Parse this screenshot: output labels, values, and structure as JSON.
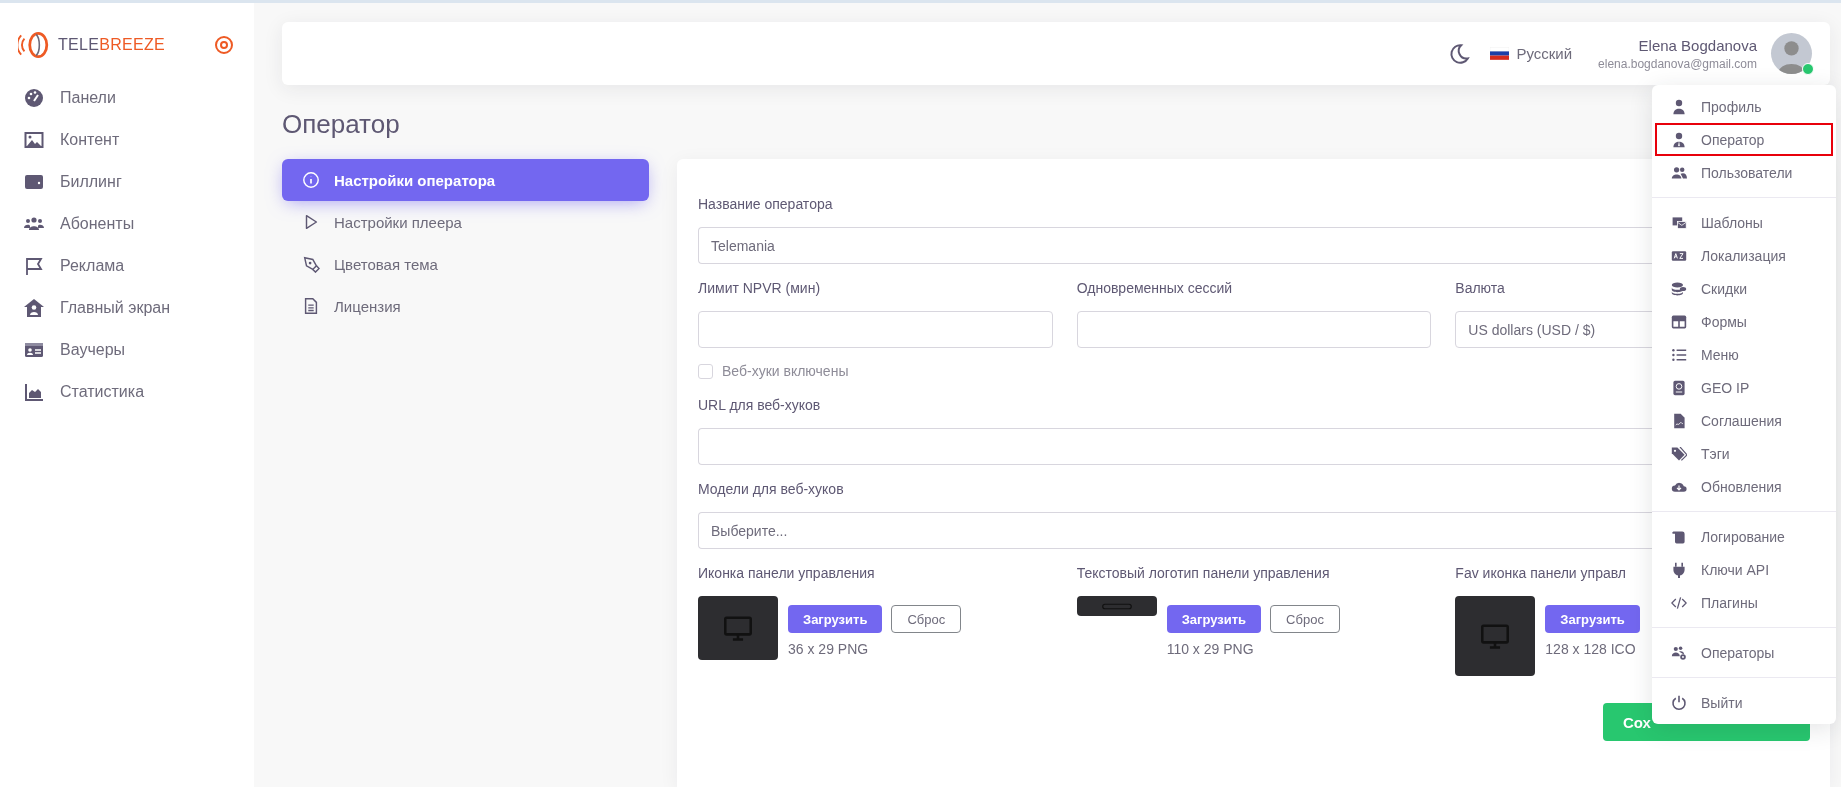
{
  "brand": {
    "name_part_1": "TELE",
    "name_part_2": "BREEZE"
  },
  "sidebar": {
    "items": [
      {
        "label": "Панели"
      },
      {
        "label": "Контент"
      },
      {
        "label": "Биллинг"
      },
      {
        "label": "Абоненты"
      },
      {
        "label": "Реклама"
      },
      {
        "label": "Главный экран"
      },
      {
        "label": "Ваучеры"
      },
      {
        "label": "Статистика"
      }
    ]
  },
  "header": {
    "language": "Русский",
    "user_name": "Elena Bogdanova",
    "user_email": "elena.bogdanova@gmail.com",
    "online": true
  },
  "page_title": "Оператор",
  "settings_nav": [
    {
      "label": "Настройки оператора",
      "selected": true
    },
    {
      "label": "Настройки плеера",
      "selected": false
    },
    {
      "label": "Цветовая тема",
      "selected": false
    },
    {
      "label": "Лицензия",
      "selected": false
    }
  ],
  "form": {
    "operator_name": {
      "label": "Название оператора",
      "value": "Telemania"
    },
    "limits": [
      {
        "label": "Лимит NPVR (мин)"
      },
      {
        "label": "Одновременных сессий"
      },
      {
        "label": "Валюта",
        "value": "US dollars (USD / $)"
      }
    ],
    "webhooks_enabled": {
      "label": "Веб-хуки включены",
      "checked": false
    },
    "webhook_url": {
      "label": "URL для веб-хуков"
    },
    "webhook_models": {
      "label": "Модели для веб-хуков",
      "placeholder": "Выберите..."
    },
    "uploads": [
      {
        "label": "Иконка панели управления",
        "kind": "square",
        "upload_button": "Загрузить",
        "reset_button": "Сброс",
        "size": "36 x 29 PNG"
      },
      {
        "label": "Текстовый логотип панели управления",
        "kind": "banner",
        "upload_button": "Загрузить",
        "reset_button": "Сброс",
        "size": "110 x 29 PNG"
      },
      {
        "label": "Fav иконка панели управл",
        "kind": "large",
        "upload_button": "Загрузить",
        "size": "128 x 128 ICO"
      }
    ],
    "save_button": "Сох"
  },
  "user_menu": {
    "groups": [
      {
        "items": [
          {
            "label": "Профиль",
            "highlighted": false
          },
          {
            "label": "Оператор",
            "highlighted": true
          },
          {
            "label": "Пользователи",
            "highlighted": false
          }
        ]
      },
      {
        "items": [
          {
            "label": "Шаблоны",
            "highlighted": false
          },
          {
            "label": "Локализация",
            "highlighted": false
          },
          {
            "label": "Скидки",
            "highlighted": false
          },
          {
            "label": "Формы",
            "highlighted": false
          },
          {
            "label": "Меню",
            "highlighted": false
          },
          {
            "label": "GEO IP",
            "highlighted": false
          },
          {
            "label": "Соглашения",
            "highlighted": false
          },
          {
            "label": "Тэги",
            "highlighted": false
          },
          {
            "label": "Обновления",
            "highlighted": false
          }
        ]
      },
      {
        "items": [
          {
            "label": "Логирование",
            "highlighted": false
          },
          {
            "label": "Ключи API",
            "highlighted": false
          },
          {
            "label": "Плагины",
            "highlighted": false
          }
        ]
      },
      {
        "items": [
          {
            "label": "Операторы",
            "highlighted": false
          }
        ]
      },
      {
        "items": [
          {
            "label": "Выйти",
            "highlighted": false
          }
        ]
      }
    ]
  }
}
